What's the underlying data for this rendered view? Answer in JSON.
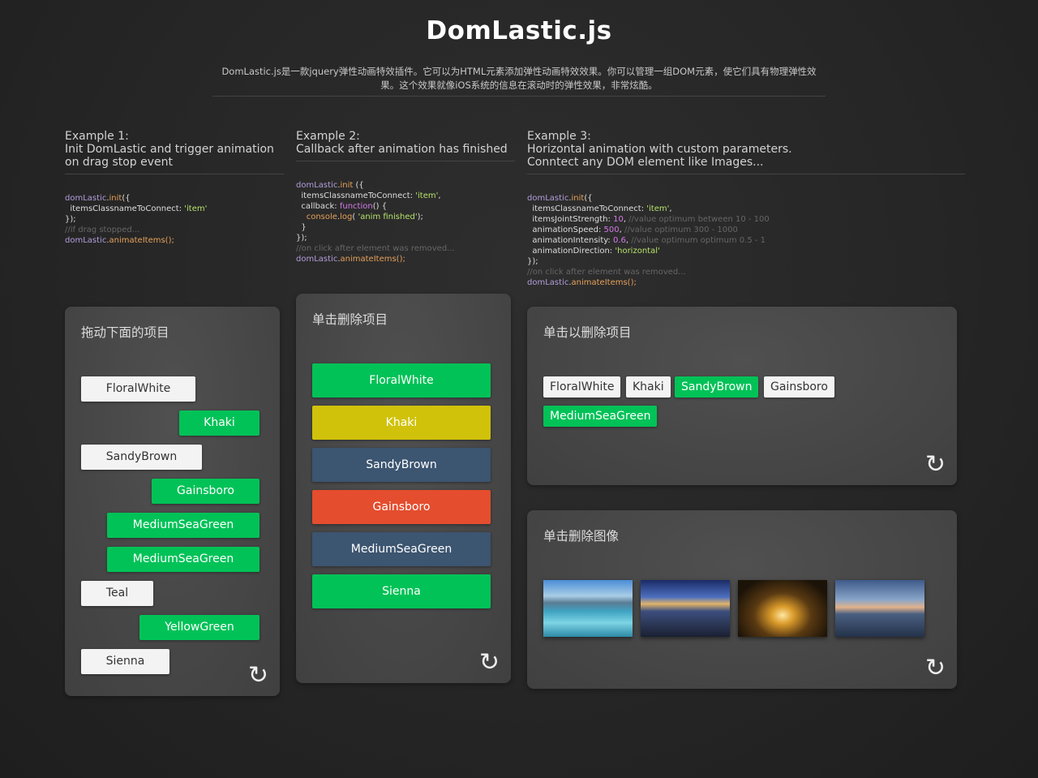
{
  "page": {
    "title": "DomLastic.js",
    "description": "DomLastic.js是一款jquery弹性动画特效插件。它可以为HTML元素添加弹性动画特效效果。你可以管理一组DOM元素，使它们具有物理弹性效果。这个效果就像iOS系统的信息在滚动时的弹性效果，非常炫酷。"
  },
  "examples": [
    {
      "label": "Example 1:",
      "heading": "Init DomLastic and trigger animation\non drag stop event",
      "panel_title": "拖动下面的项目",
      "items": [
        "FloralWhite",
        "Khaki",
        "SandyBrown",
        "Gainsboro",
        "MediumSeaGreen",
        "MediumSeaGreen",
        "Teal",
        "YellowGreen",
        "Sienna"
      ]
    },
    {
      "label": "Example 2:",
      "heading": "Callback after animation has finished",
      "panel_title": "单击删除项目",
      "items": [
        "FloralWhite",
        "Khaki",
        "SandyBrown",
        "Gainsboro",
        "MediumSeaGreen",
        "Sienna"
      ]
    },
    {
      "label": "Example 3:",
      "heading": "Horizontal animation with custom parameters.\nConntect any DOM element like Images...",
      "panel_title": "单击以删除项目",
      "items": [
        "FloralWhite",
        "Khaki",
        "SandyBrown",
        "Gainsboro",
        "MediumSeaGreen"
      ],
      "image_panel_title": "单击删除图像"
    }
  ],
  "reset_icon": "↻",
  "colors": {
    "white": "#f3f3f3",
    "green": "#00c257",
    "yellow": "#d0c20b",
    "slate": "#3c5570",
    "red": "#e44d2e"
  }
}
